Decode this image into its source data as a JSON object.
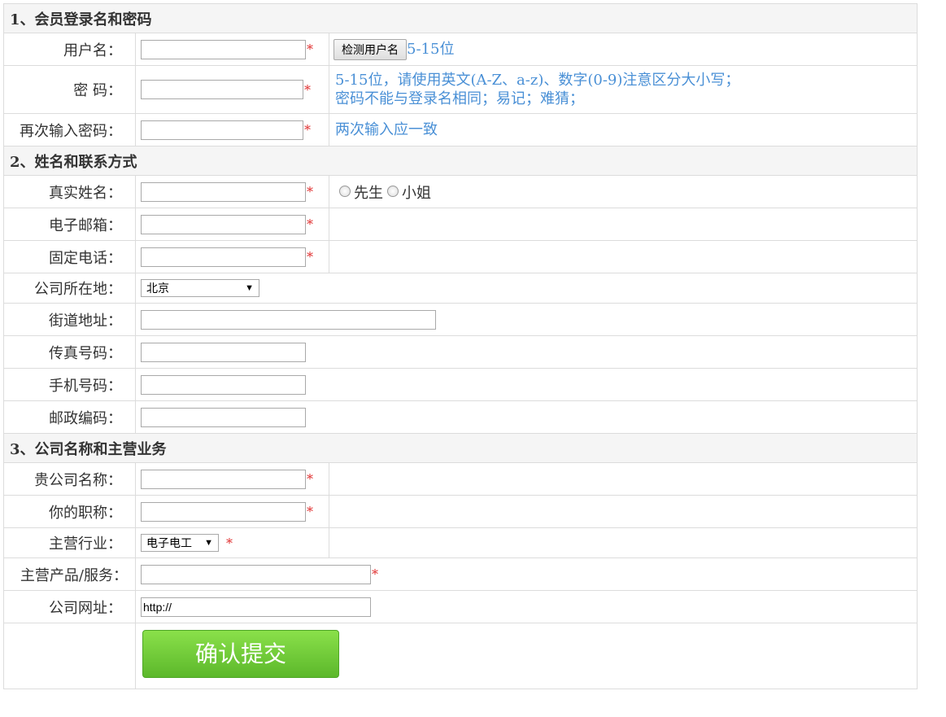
{
  "sections": {
    "s1": "1、会员登录名和密码",
    "s2": "2、姓名和联系方式",
    "s3": "3、公司名称和主营业务"
  },
  "labels": {
    "username": "用户名：",
    "password": "密 码：",
    "password_confirm": "再次输入密码：",
    "real_name": "真实姓名：",
    "email": "电子邮箱：",
    "phone": "固定电话：",
    "company_location": "公司所在地：",
    "street": "街道地址：",
    "fax": "传真号码：",
    "mobile": "手机号码：",
    "postcode": "邮政编码：",
    "company_name": "贵公司名称：",
    "job_title": "你的职称：",
    "industry": "主营行业：",
    "products": "主营产品/服务：",
    "website": "公司网址："
  },
  "required_mark": "*",
  "buttons": {
    "check_username": "检测用户名",
    "submit": "确认提交"
  },
  "hints": {
    "username": "5-15位",
    "password_line1": "5-15位，请使用英文(A-Z、a-z)、数字(0-9)注意区分大小写；",
    "password_line2": "密码不能与登录名相同；易记；难猜；",
    "password_confirm": "两次输入应一致"
  },
  "gender": {
    "male": "先生",
    "female": "小姐"
  },
  "selects": {
    "company_location": "北京",
    "industry": "电子电工"
  },
  "values": {
    "website": "http://"
  },
  "colors": {
    "hint": "#4a90d6",
    "required": "#e03030",
    "section_bg": "#f5f5f5",
    "submit_green": "#6cc63a"
  }
}
